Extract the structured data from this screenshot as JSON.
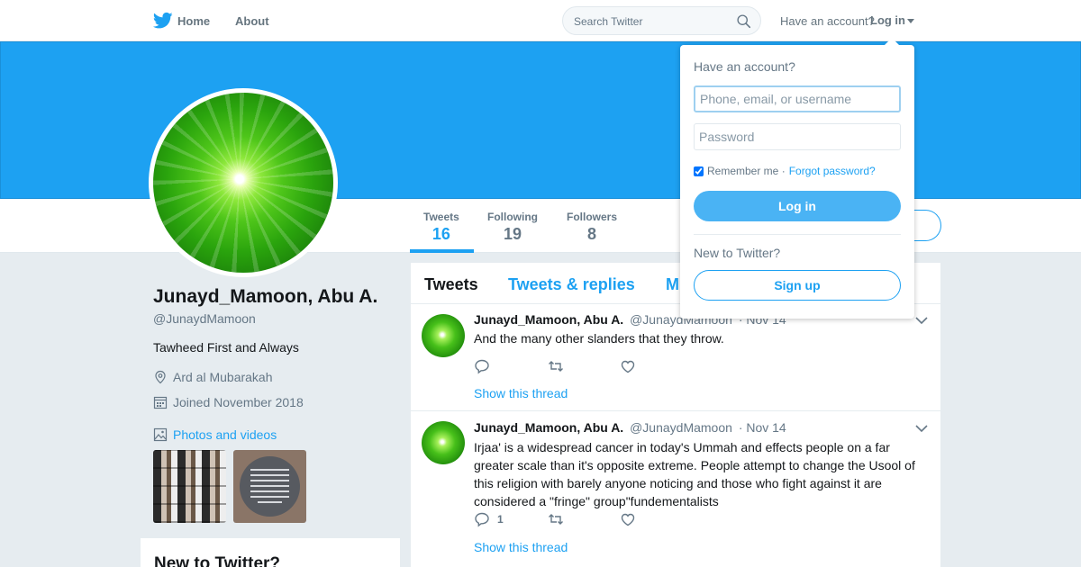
{
  "topnav": {
    "home": "Home",
    "about": "About",
    "search_placeholder": "Search Twitter",
    "have_account": "Have an account?",
    "login": "Log in"
  },
  "profile": {
    "name": "Junayd_Mamoon, Abu A.",
    "handle": "@JunaydMamoon",
    "bio": "Tawheed First and Always",
    "location": "Ard al Mubarakah",
    "joined": "Joined November 2018",
    "photos_link": "Photos and videos"
  },
  "stats": [
    {
      "label": "Tweets",
      "value": "16"
    },
    {
      "label": "Following",
      "value": "19"
    },
    {
      "label": "Followers",
      "value": "8"
    }
  ],
  "timeline": {
    "tabs": [
      "Tweets",
      "Tweets & replies",
      "M"
    ],
    "tweets": [
      {
        "name": "Junayd_Mamoon, Abu A.",
        "handle": "@JunaydMamoon",
        "date": "· Nov 14",
        "text": "And the many other slanders that they throw.",
        "reply_count": "",
        "thread": "Show this thread"
      },
      {
        "name": "Junayd_Mamoon, Abu A.",
        "handle": "@JunaydMamoon",
        "date": "· Nov 14",
        "text": "Irjaa' is a widespread  cancer in today's Ummah and effects people on a far greater scale than it's opposite extreme. People  attempt to change the Usool of this religion with barely anyone noticing and those who fight against it are considered a \"fringe\" group\"fundementalists",
        "reply_count": "1",
        "thread": "Show this thread"
      }
    ]
  },
  "sidebar_box": {
    "title": "New to Twitter?"
  },
  "login_dropdown": {
    "title": "Have an account?",
    "username_placeholder": "Phone, email, or username",
    "password_placeholder": "Password",
    "remember": "Remember me ·",
    "forgot": "Forgot password?",
    "login_button": "Log in",
    "new_to_twitter": "New to Twitter?",
    "signup_button": "Sign up"
  },
  "colors": {
    "accent": "#1da1f2",
    "banner": "#1da1f2",
    "background": "#e6ecf0"
  }
}
